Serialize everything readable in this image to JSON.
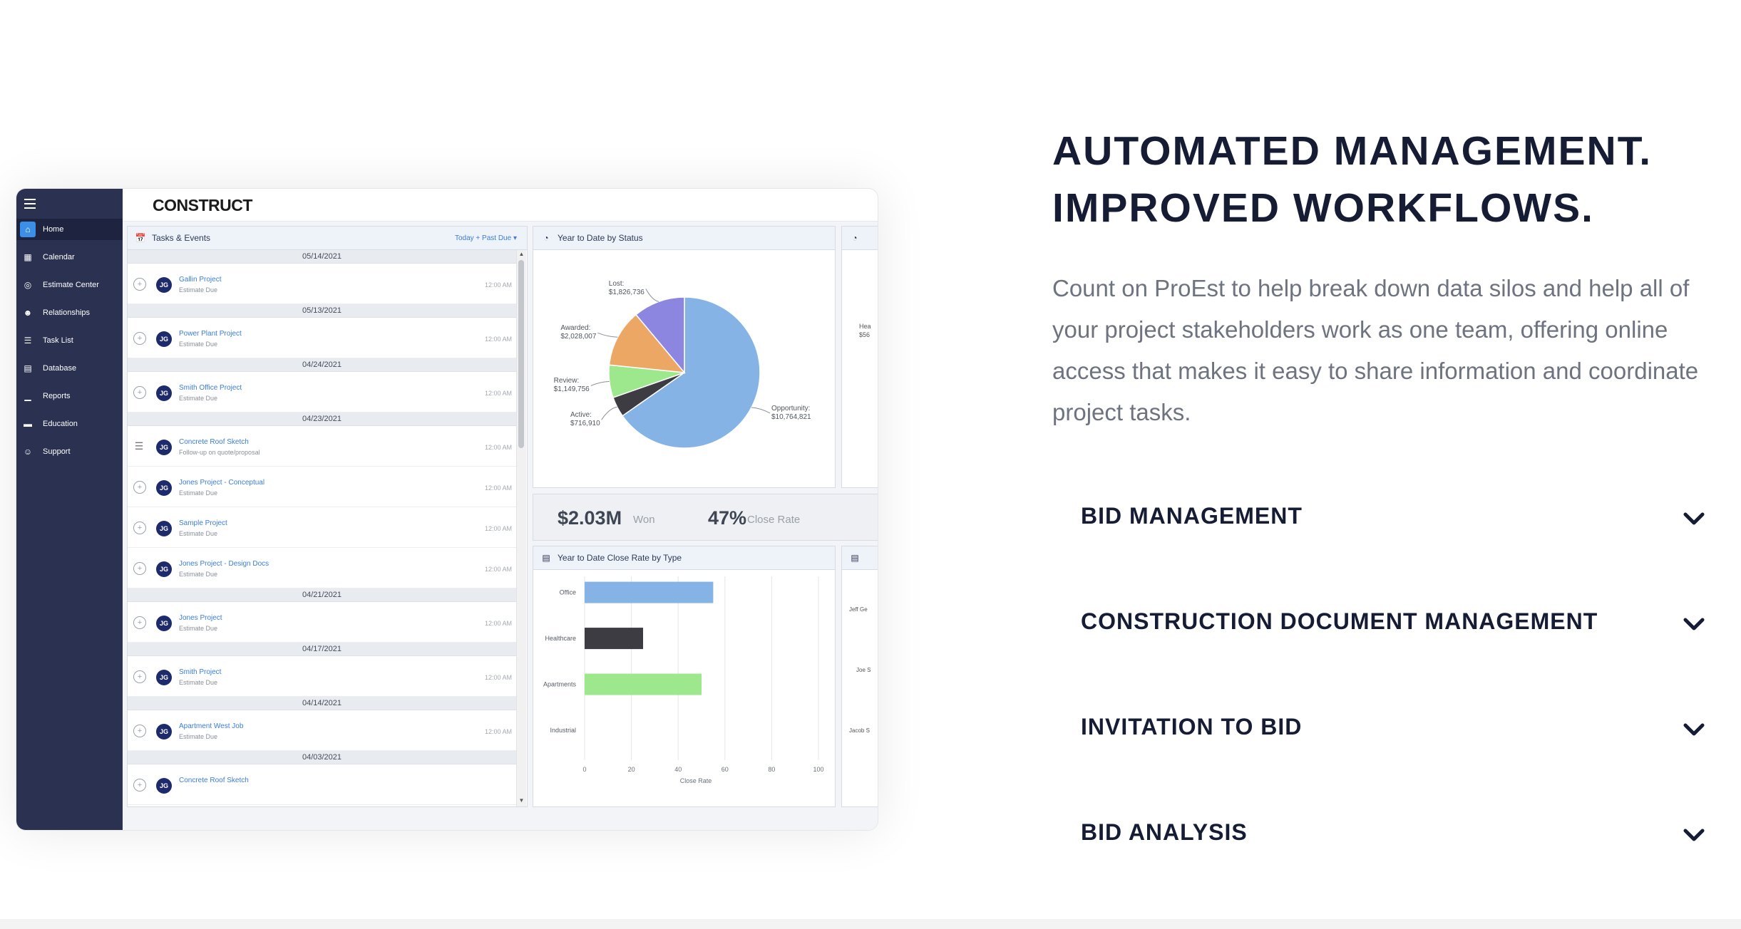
{
  "app": {
    "logo": "CONSTRUCT",
    "nav": [
      {
        "label": "Home",
        "icon": "home-icon",
        "active": true
      },
      {
        "label": "Calendar",
        "icon": "calendar-icon",
        "active": false
      },
      {
        "label": "Estimate Center",
        "icon": "estimate-icon",
        "active": false
      },
      {
        "label": "Relationships",
        "icon": "users-icon",
        "active": false
      },
      {
        "label": "Task List",
        "icon": "task-list-icon",
        "active": false
      },
      {
        "label": "Database",
        "icon": "database-icon",
        "active": false
      },
      {
        "label": "Reports",
        "icon": "reports-icon",
        "active": false
      },
      {
        "label": "Education",
        "icon": "education-icon",
        "active": false
      },
      {
        "label": "Support",
        "icon": "support-icon",
        "active": false
      }
    ],
    "tasks": {
      "title": "Tasks & Events",
      "filter": "Today + Past Due",
      "items": [
        {
          "type": "date",
          "date": "05/14/2021"
        },
        {
          "type": "task",
          "title": "Gallin Project",
          "sub": "Estimate Due",
          "time": "12:00 AM",
          "initials": "JG",
          "icon": "plus"
        },
        {
          "type": "date",
          "date": "05/13/2021"
        },
        {
          "type": "task",
          "title": "Power Plant Project",
          "sub": "Estimate Due",
          "time": "12:00 AM",
          "initials": "JG",
          "icon": "plus"
        },
        {
          "type": "date",
          "date": "04/24/2021"
        },
        {
          "type": "task",
          "title": "Smith Office Project",
          "sub": "Estimate Due",
          "time": "12:00 AM",
          "initials": "JG",
          "icon": "plus"
        },
        {
          "type": "date",
          "date": "04/23/2021"
        },
        {
          "type": "task",
          "title": "Concrete Roof Sketch",
          "sub": "Follow-up on quote/proposal",
          "time": "12:00 AM",
          "initials": "JG",
          "icon": "list"
        },
        {
          "type": "task",
          "title": "Jones Project - Conceptual",
          "sub": "Estimate Due",
          "time": "12:00 AM",
          "initials": "JG",
          "icon": "plus"
        },
        {
          "type": "task",
          "title": "Sample Project",
          "sub": "Estimate Due",
          "time": "12:00 AM",
          "initials": "JG",
          "icon": "plus"
        },
        {
          "type": "task",
          "title": "Jones Project - Design Docs",
          "sub": "Estimate Due",
          "time": "12:00 AM",
          "initials": "JG",
          "icon": "plus"
        },
        {
          "type": "date",
          "date": "04/21/2021"
        },
        {
          "type": "task",
          "title": "Jones Project",
          "sub": "Estimate Due",
          "time": "12:00 AM",
          "initials": "JG",
          "icon": "plus"
        },
        {
          "type": "date",
          "date": "04/17/2021"
        },
        {
          "type": "task",
          "title": "Smith Project",
          "sub": "Estimate Due",
          "time": "12:00 AM",
          "initials": "JG",
          "icon": "plus"
        },
        {
          "type": "date",
          "date": "04/14/2021"
        },
        {
          "type": "task",
          "title": "Apartment West Job",
          "sub": "Estimate Due",
          "time": "12:00 AM",
          "initials": "JG",
          "icon": "plus"
        },
        {
          "type": "date",
          "date": "04/03/2021"
        },
        {
          "type": "task",
          "title": "Concrete Roof Sketch",
          "sub": "",
          "time": "",
          "initials": "JG",
          "icon": "plus"
        }
      ]
    },
    "pie_title": "Year to Date by Status",
    "bar_title": "Year to Date Close Rate by Type",
    "side_text_1": "Hea",
    "side_text_2": "$56",
    "side_names": [
      "Jeff Ge",
      "Joe S",
      "Jacob S"
    ],
    "metrics": [
      {
        "value": "$2.03M",
        "label": "Won"
      },
      {
        "value": "47%",
        "label": "Close Rate"
      },
      {
        "value": "$",
        "label": ""
      }
    ]
  },
  "chart_data": [
    {
      "type": "pie",
      "title": "Year to Date by Status",
      "labels": [
        "Opportunity",
        "Active",
        "Review",
        "Awarded",
        "Lost"
      ],
      "values": [
        10764821,
        716910,
        1149756,
        2028007,
        1826736
      ],
      "value_labels": [
        "$10,764,821",
        "$716,910",
        "$1,149,756",
        "$2,028,007",
        "$1,826,736"
      ],
      "colors": [
        "#86b3e6",
        "#3c3c42",
        "#9de88d",
        "#eda765",
        "#8d86e0"
      ]
    },
    {
      "type": "bar",
      "orientation": "horizontal",
      "title": "Year to Date Close Rate by Type",
      "categories": [
        "Office",
        "Healthcare",
        "Apartments",
        "Industrial"
      ],
      "values": [
        55,
        25,
        50,
        0
      ],
      "colors": [
        "#86b3e6",
        "#3c3c42",
        "#9de88d",
        "#cccccc"
      ],
      "xlabel": "Close Rate",
      "xlim": [
        0,
        100
      ],
      "xticks": [
        0,
        20,
        40,
        60,
        80,
        100
      ]
    }
  ],
  "hero": {
    "title_line1": "AUTOMATED MANAGEMENT.",
    "title_line2": "IMPROVED WORKFLOWS.",
    "body": "Count on ProEst to help break down data silos and help all of your project stakeholders work as one team, offering online access that makes it easy to share information and coordinate project tasks."
  },
  "accordion": [
    {
      "label": "BID MANAGEMENT"
    },
    {
      "label": "CONSTRUCTION DOCUMENT MANAGEMENT"
    },
    {
      "label": "INVITATION TO BID"
    },
    {
      "label": "BID ANALYSIS"
    }
  ]
}
